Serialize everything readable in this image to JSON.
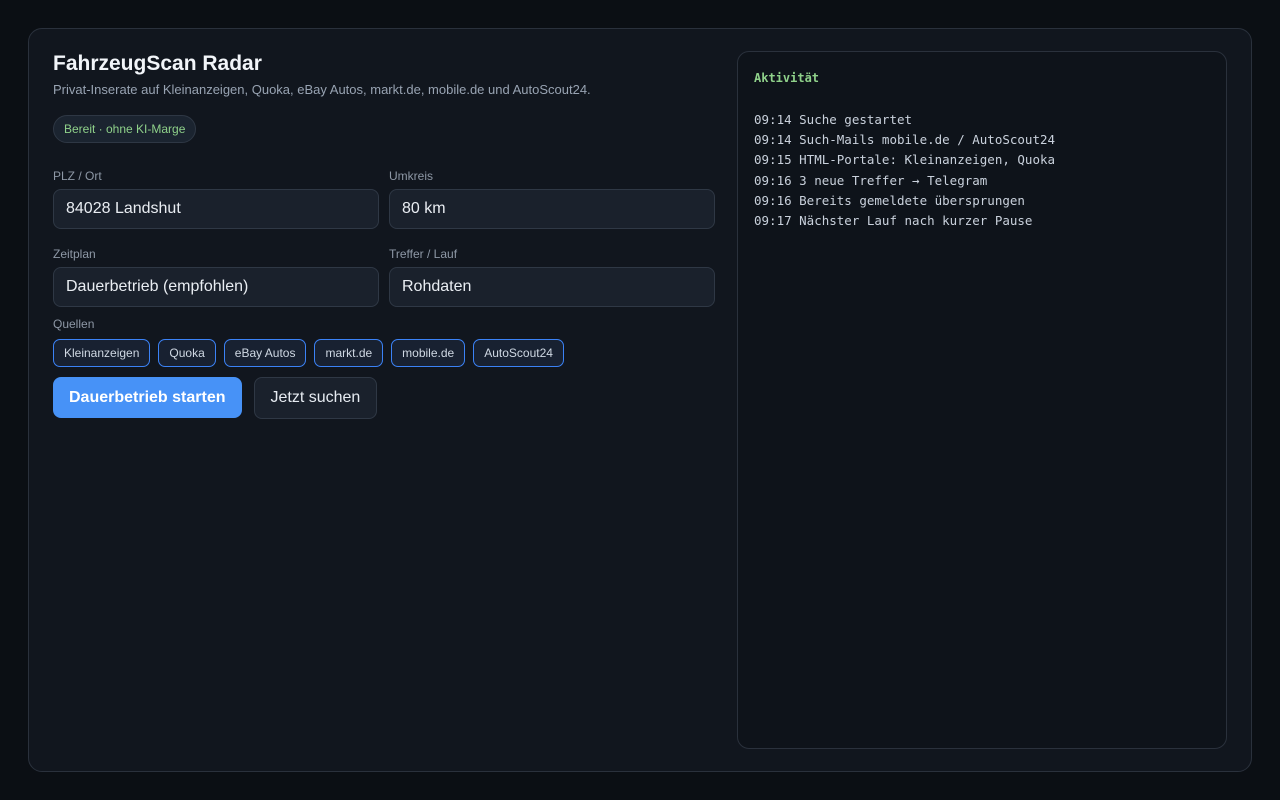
{
  "app": {
    "title": "FahrzeugScan Radar",
    "subtitle": "Privat-Inserate auf Kleinanzeigen, Quoka, eBay Autos, markt.de, mobile.de und AutoScout24.",
    "status": "Bereit · ohne KI-Marge"
  },
  "form": {
    "location": {
      "label": "PLZ / Ort",
      "value": "84028 Landshut"
    },
    "radius": {
      "label": "Umkreis",
      "value": "80 km"
    },
    "schedule": {
      "label": "Zeitplan",
      "value": "Dauerbetrieb (empfohlen)"
    },
    "hits": {
      "label": "Treffer / Lauf",
      "value": "Rohdaten"
    }
  },
  "sources": {
    "label": "Quellen",
    "items": [
      "Kleinanzeigen",
      "Quoka",
      "eBay Autos",
      "markt.de",
      "mobile.de",
      "AutoScout24"
    ]
  },
  "actions": {
    "start_label": "Dauerbetrieb starten",
    "search_label": "Jetzt suchen"
  },
  "log": {
    "title": "Aktivität",
    "entries": [
      "09:14 Suche gestartet",
      "09:14 Such-Mails mobile.de / AutoScout24",
      "09:15 HTML-Portale: Kleinanzeigen, Quoka",
      "09:16 3 neue Treffer → Telegram",
      "09:16 Bereits gemeldete übersprungen",
      "09:17 Nächster Lauf nach kurzer Pause"
    ]
  },
  "colors": {
    "accent": "#4792f7",
    "status_green": "#8fd18a",
    "background": "#11161e"
  }
}
